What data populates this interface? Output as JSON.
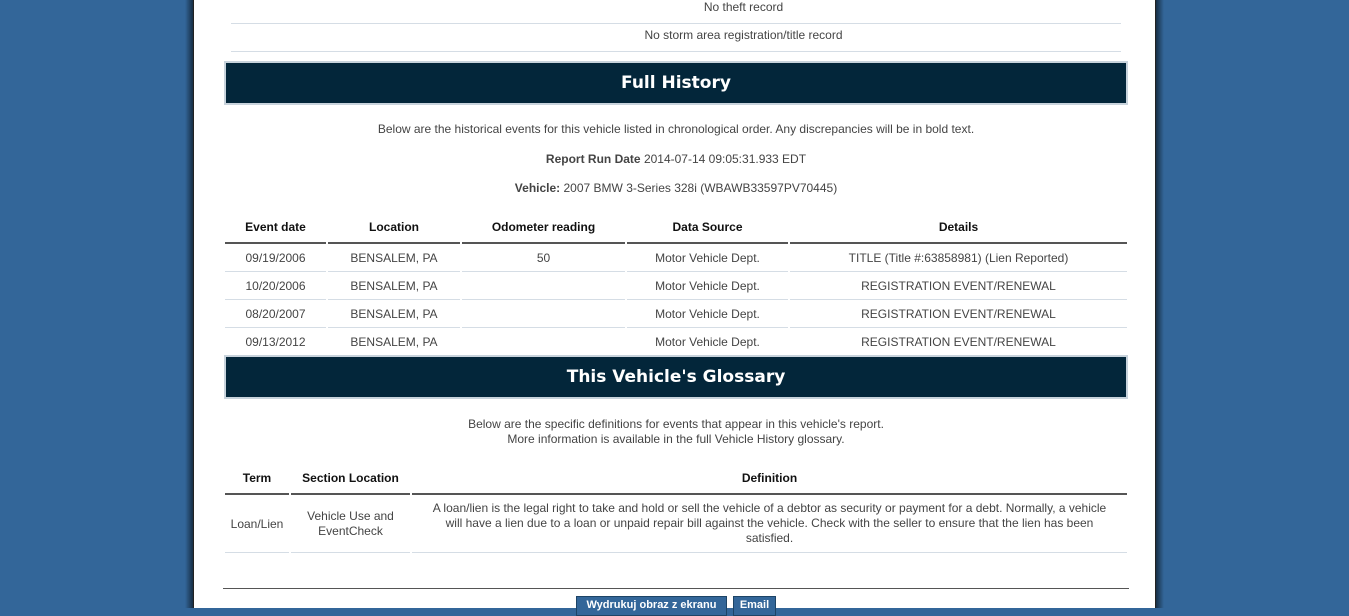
{
  "records": {
    "no_theft": "No theft record",
    "no_storm": "No storm area registration/title record"
  },
  "full_history": {
    "title": "Full History",
    "intro": "Below are the historical events for this vehicle listed in chronological order. Any discrepancies will be in bold text.",
    "report_run_label": "Report Run Date",
    "report_run_value": "2014-07-14 09:05:31.933 EDT",
    "vehicle_label": "Vehicle:",
    "vehicle_value": "2007 BMW 3-Series 328i (WBAWB33597PV70445)",
    "columns": [
      "Event date",
      "Location",
      "Odometer reading",
      "Data Source",
      "Details"
    ],
    "rows": [
      [
        "09/19/2006",
        "BENSALEM, PA",
        "50",
        "Motor Vehicle Dept.",
        "TITLE (Title #:63858981) (Lien Reported)"
      ],
      [
        "10/20/2006",
        "BENSALEM, PA",
        "",
        "Motor Vehicle Dept.",
        "REGISTRATION EVENT/RENEWAL"
      ],
      [
        "08/20/2007",
        "BENSALEM, PA",
        "",
        "Motor Vehicle Dept.",
        "REGISTRATION EVENT/RENEWAL"
      ],
      [
        "09/13/2012",
        "BENSALEM, PA",
        "",
        "Motor Vehicle Dept.",
        "REGISTRATION EVENT/RENEWAL"
      ]
    ]
  },
  "glossary": {
    "title": "This Vehicle's Glossary",
    "intro_line1": "Below are the specific definitions for events that appear in this vehicle's report.",
    "intro_line2": "More information is available in the full Vehicle History glossary.",
    "columns": [
      "Term",
      "Section Location",
      "Definition"
    ],
    "rows": [
      [
        "Loan/Lien",
        "Vehicle Use and EventCheck",
        "A loan/lien is the legal right to take and hold or sell the vehicle of a debtor as security or payment for a debt. Normally, a vehicle will have a lien due to a loan or unpaid repair bill against the vehicle. Check with the seller to ensure that the lien has been satisfied."
      ]
    ]
  },
  "buttons": {
    "print": "Wydrukuj obraz z ekranu",
    "email": "Email"
  },
  "colors": {
    "background": "#336699",
    "banner": "#03263a",
    "button": "#336699"
  }
}
